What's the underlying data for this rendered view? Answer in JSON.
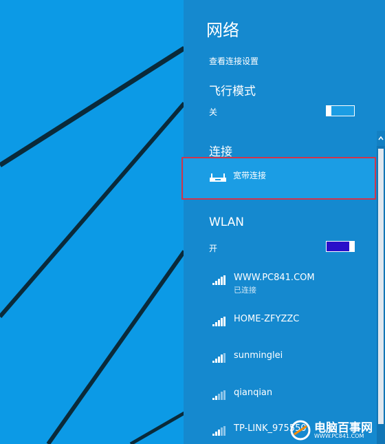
{
  "panel": {
    "title": "网络",
    "settings_link": "查看连接设置",
    "airplane": {
      "heading": "飞行模式",
      "state": "关"
    },
    "connection": {
      "heading": "连接",
      "broadband_label": "宽带连接"
    },
    "wlan": {
      "heading": "WLAN",
      "state": "开",
      "networks": [
        {
          "name": "WWW.PC841.COM",
          "status": "已连接"
        },
        {
          "name": "HOME-ZFYZZC",
          "status": ""
        },
        {
          "name": "sunminglei",
          "status": ""
        },
        {
          "name": "qianqian",
          "status": ""
        },
        {
          "name": "TP-LINK_975550",
          "status": ""
        }
      ]
    }
  },
  "watermark": {
    "brand": "电脑百事网",
    "url": "WWW.PC841.COM"
  },
  "colors": {
    "panel": "#1589cf",
    "desktop": "#0c9ae6",
    "highlight_border": "#d0354b",
    "wlan_toggle": "#2a0fc9"
  },
  "icons": {
    "broadband": "router-icon",
    "wifi": "wifi-signal-icon"
  }
}
